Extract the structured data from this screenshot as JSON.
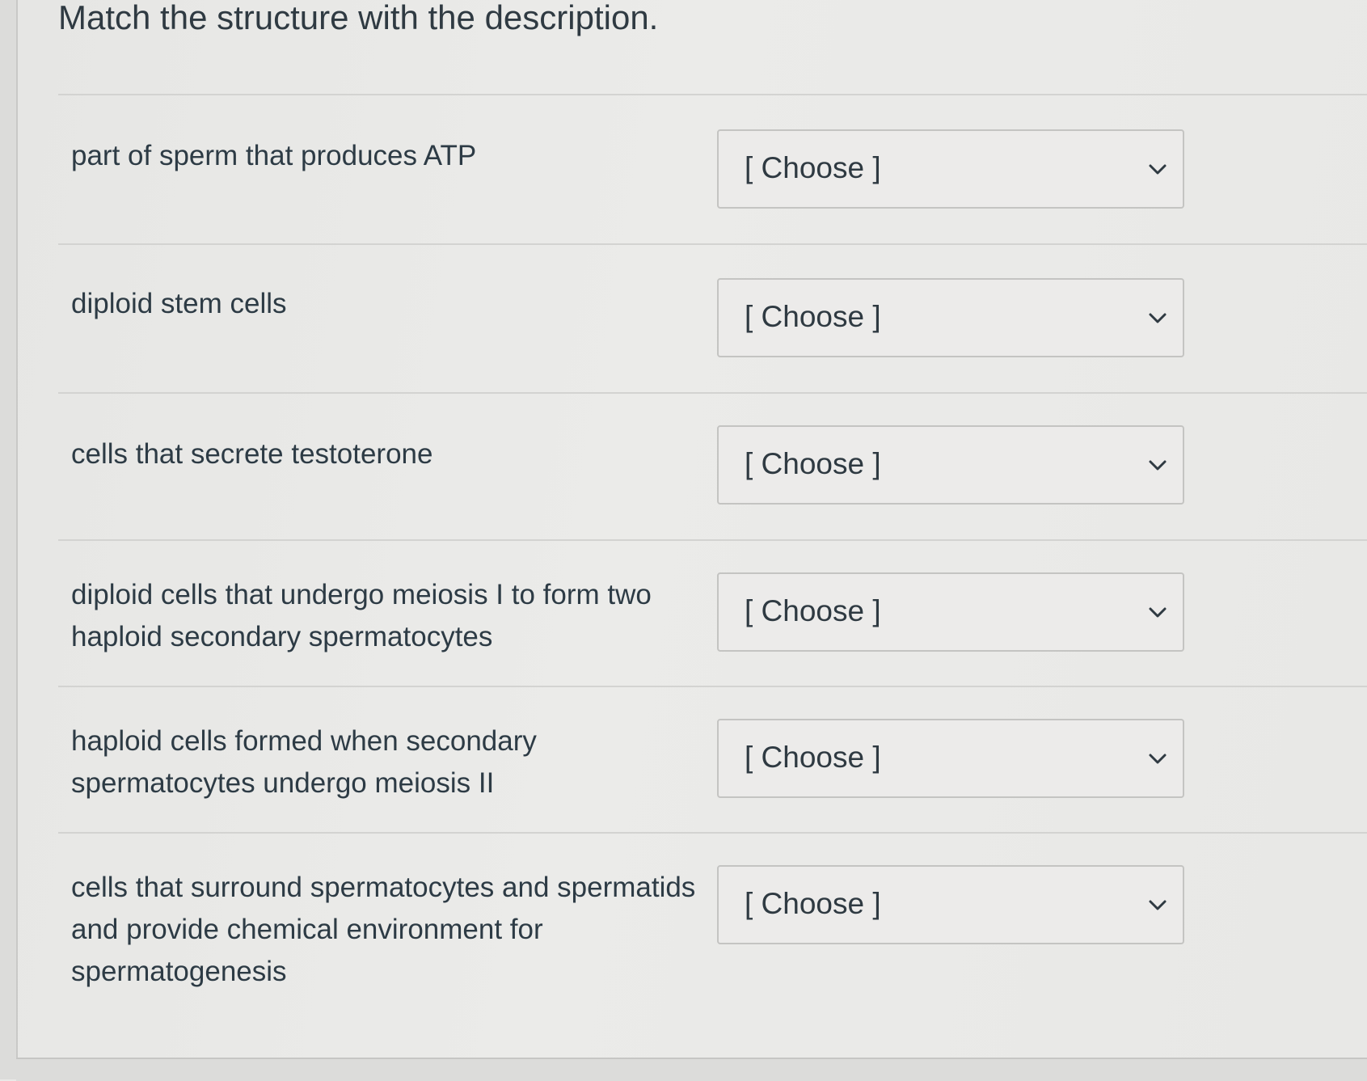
{
  "question": {
    "title": "Match the structure with the description."
  },
  "rows": [
    {
      "description": "part of sperm that produces ATP",
      "selected": "[ Choose ]"
    },
    {
      "description": "diploid stem cells",
      "selected": "[ Choose ]"
    },
    {
      "description": "cells that secrete testoterone",
      "selected": "[ Choose ]"
    },
    {
      "description": "diploid cells that undergo meiosis I to form two haploid secondary spermatocytes",
      "selected": "[ Choose ]"
    },
    {
      "description": "haploid cells formed when secondary spermatocytes undergo meiosis II",
      "selected": "[ Choose ]"
    },
    {
      "description": "cells that surround spermatocytes and spermatids and provide chemical environment for spermatogenesis",
      "selected": "[ Choose ]"
    }
  ],
  "icons": {
    "dropdown": "chevron-down-icon"
  }
}
